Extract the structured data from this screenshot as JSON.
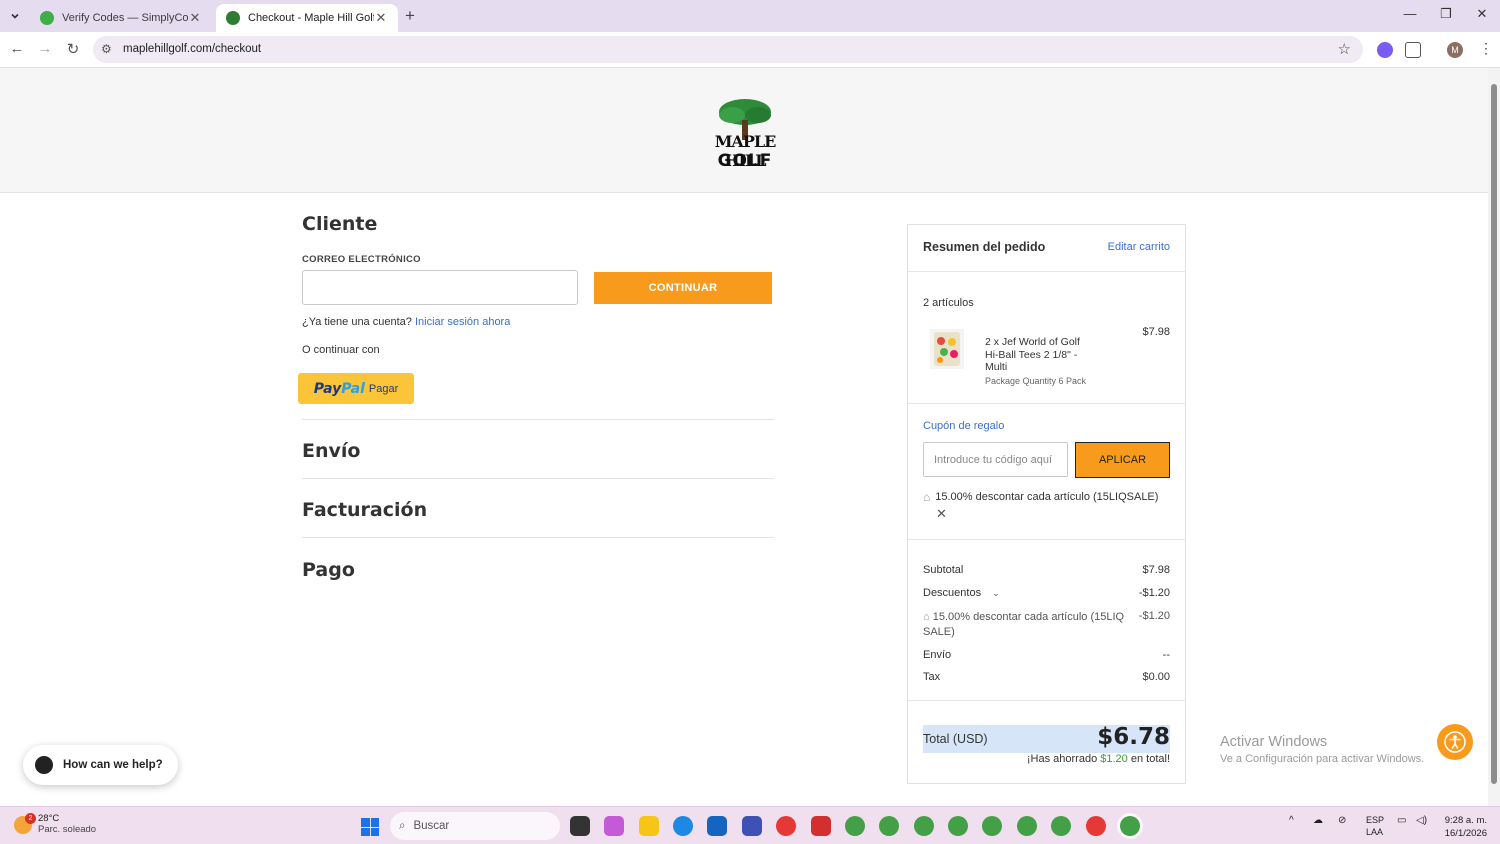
{
  "browser": {
    "tabs": [
      {
        "title": "Verify Codes — SimplyCodes",
        "active": false
      },
      {
        "title": "Checkout - Maple Hill Golf",
        "active": true
      }
    ],
    "url": "maplehillgolf.com/checkout",
    "profile_initial": "M"
  },
  "header": {
    "logo_text_top": "MAPLE HILL",
    "logo_text_bottom": "GOLF"
  },
  "checkout": {
    "customer_heading": "Cliente",
    "email_label": "CORREO ELECTRÓNICO",
    "email_value": "",
    "continue_label": "CONTINUAR",
    "have_account_text": "¿Ya tiene una cuenta?",
    "login_link": "Iniciar sesión ahora",
    "or_continue": "O continuar con",
    "paypal_logo_a": "Pay",
    "paypal_logo_b": "Pal",
    "paypal_pay": "Pagar",
    "shipping_heading": "Envío",
    "billing_heading": "Facturación",
    "payment_heading": "Pago"
  },
  "summary": {
    "title": "Resumen del pedido",
    "edit_cart": "Editar carrito",
    "items_count": "2 artículos",
    "item": {
      "name": "2 x Jef World of Golf Hi-Ball Tees 2 1/8\" - Multi",
      "option": "Package Quantity 6 Pack",
      "price": "$7.98"
    },
    "coupon_link": "Cupón de regalo",
    "coupon_placeholder": "Introduce tu código aquí",
    "apply_label": "APLICAR",
    "applied_coupon": "15.00% descontar cada artículo (15LIQSALE)",
    "subtotal_label": "Subtotal",
    "subtotal_value": "$7.98",
    "discounts_label": "Descuentos",
    "discounts_value": "-$1.20",
    "discount_detail": "15.00% descontar cada artículo (15LIQ SALE)",
    "discount_detail_value": "-$1.20",
    "shipping_label": "Envío",
    "shipping_value": "--",
    "tax_label": "Tax",
    "tax_value": "$0.00",
    "total_label": "Total (USD)",
    "total_value": "$6.78",
    "saved_prefix": "¡Has ahorrado",
    "saved_amount": "$1.20",
    "saved_suffix": "en total!"
  },
  "help_widget": {
    "label": "How can we help?"
  },
  "windows_watermark": {
    "line1": "Activar Windows",
    "line2": "Ve a Configuración para activar Windows."
  },
  "taskbar": {
    "weather_temp": "28°C",
    "weather_desc": "Parc. soleado",
    "weather_badge": "2",
    "search_placeholder": "Buscar",
    "lang_top": "ESP",
    "lang_bottom": "LAA",
    "time": "9:28 a. m.",
    "date": "16/1/2026"
  },
  "colors": {
    "accent_orange": "#f89a1c",
    "link_blue": "#3a6fc7",
    "paypal_yellow": "#fbc439",
    "total_highlight": "#d6e6f8"
  }
}
